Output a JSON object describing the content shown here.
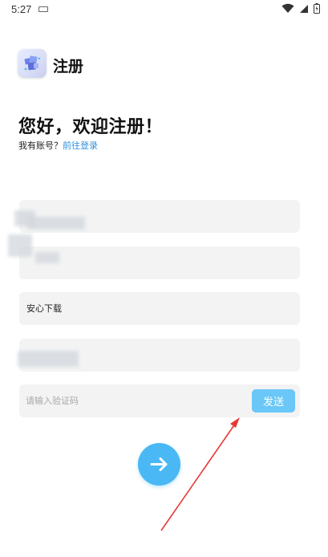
{
  "status_bar": {
    "time": "5:27"
  },
  "header": {
    "app_title": "注册",
    "logo_icon": "app-logo-icon"
  },
  "greeting": {
    "title": "您好，欢迎注册！",
    "has_account_text": "我有账号？",
    "login_link": "前往登录"
  },
  "form": {
    "field_1_value": "",
    "field_2_value": "",
    "field_3_value": "安心下载",
    "field_4_value": "",
    "code_placeholder": "请输入验证码",
    "send_button": "发送"
  },
  "submit": {
    "icon": "arrow-right-icon"
  },
  "colors": {
    "accent": "#49b8f5",
    "send_button_bg": "#6ac7f7",
    "link": "#2f8fdc",
    "field_bg": "#f3f3f3",
    "annotation_arrow": "#e53935"
  }
}
